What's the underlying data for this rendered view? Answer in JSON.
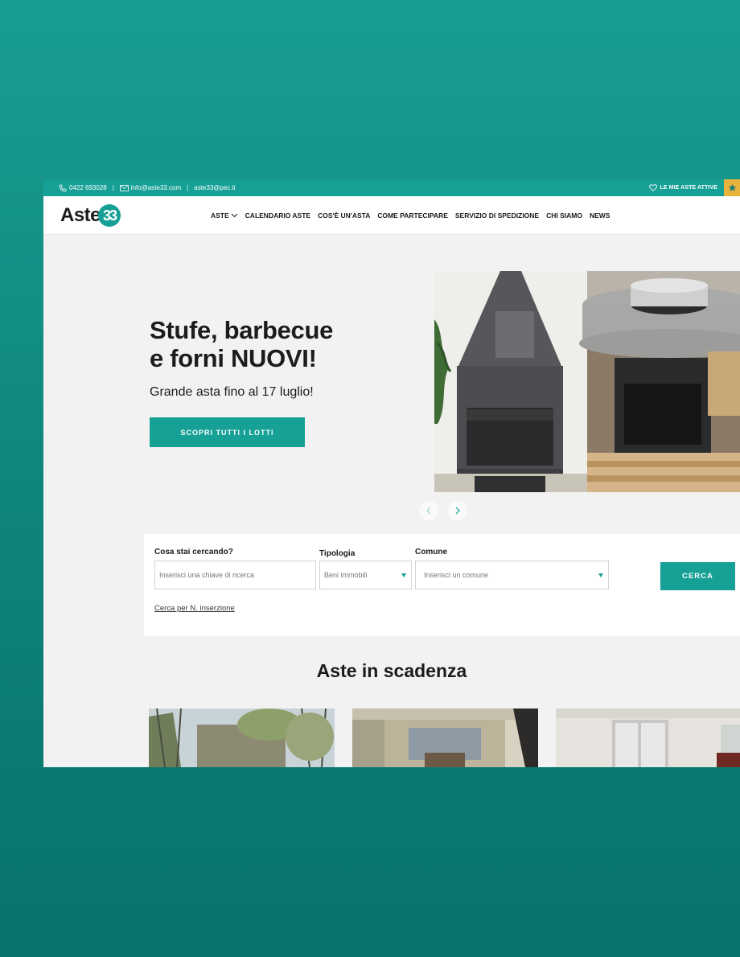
{
  "topbar": {
    "phone": "0422 693028",
    "email": "info@aste33.com",
    "pec": "aste33@pec.it",
    "separator": "|",
    "my_auctions": "LE MIE ASTE ATTIVE"
  },
  "header": {
    "logo_word": "Aste",
    "logo_number": "33",
    "nav": [
      {
        "label": "ASTE"
      },
      {
        "label": "CALENDARIO ASTE"
      },
      {
        "label": "COS'È UN'ASTA"
      },
      {
        "label": "COME PARTECIPARE"
      },
      {
        "label": "SERVIZIO DI SPEDIZIONE"
      },
      {
        "label": "CHI SIAMO"
      },
      {
        "label": "NEWS"
      }
    ]
  },
  "hero": {
    "title_line1": "Stufe, barbecue",
    "title_line2": "e forni NUOVI!",
    "subtitle": "Grande asta fino al 17 luglio!",
    "button": "SCOPRI TUTTI I LOTTI"
  },
  "search": {
    "keyword_label": "Cosa stai cercando?",
    "keyword_placeholder": "Inserisci una chiave di ricerca",
    "type_label": "Tipologia",
    "type_value": "Beni immobili",
    "city_label": "Comune",
    "city_value": "Inserisci un comune",
    "submit": "CERCA",
    "link": "Cerca per N. inserzione"
  },
  "listing": {
    "title": "Aste in scadenza"
  },
  "colors": {
    "accent": "#16a096",
    "star": "#e9b23c",
    "background_top": "#1a9e92",
    "background_bottom": "#07736b"
  }
}
